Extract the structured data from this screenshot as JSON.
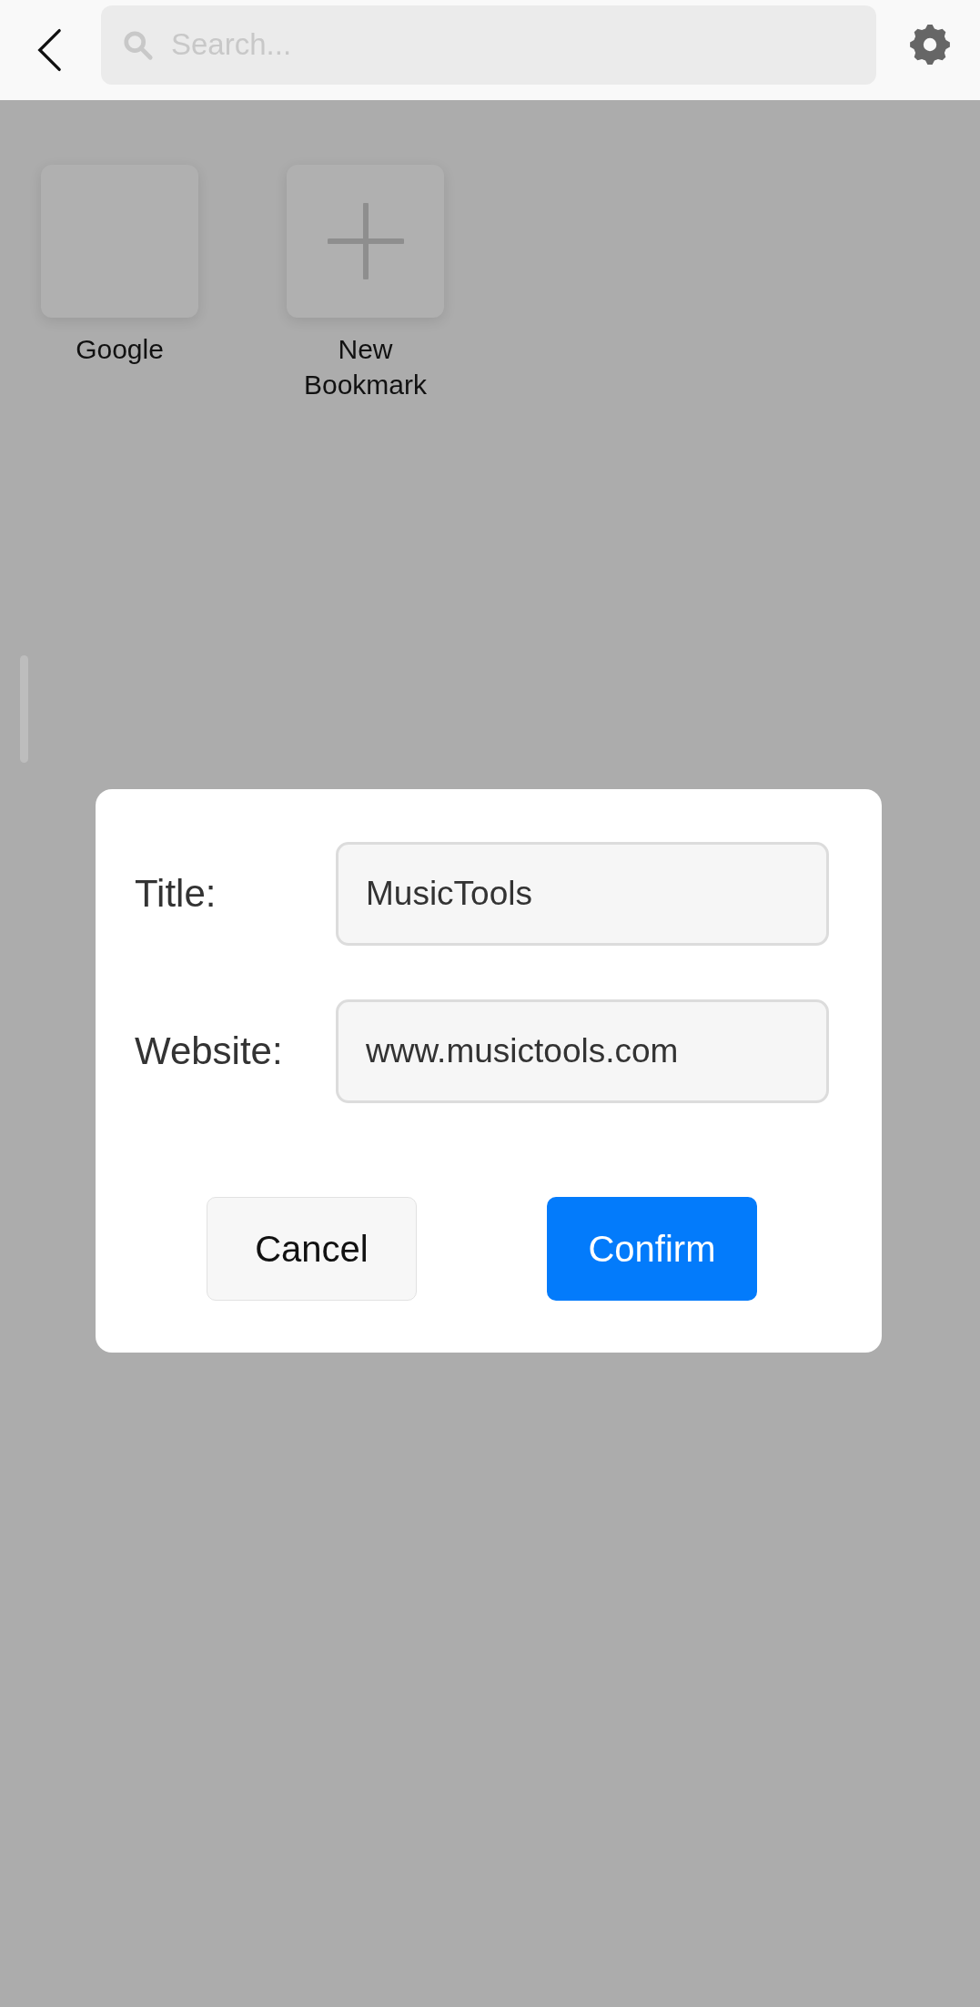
{
  "top_bar": {
    "search": {
      "placeholder": "Search..."
    }
  },
  "bookmarks": [
    {
      "label": "Google",
      "kind": "site"
    },
    {
      "label": "New\nBookmark",
      "kind": "add"
    }
  ],
  "dialog": {
    "fields": [
      {
        "label": "Title:",
        "value": "MusicTools"
      },
      {
        "label": "Website:",
        "value": "www.musictools.com"
      }
    ],
    "buttons": [
      {
        "label": "Cancel",
        "kind": "secondary"
      },
      {
        "label": "Confirm",
        "kind": "primary"
      }
    ]
  }
}
